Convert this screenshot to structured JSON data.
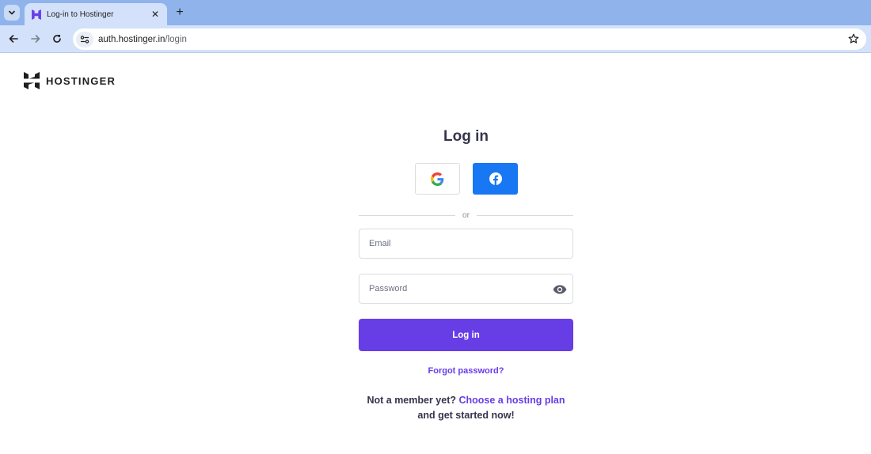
{
  "browser": {
    "tab_title": "Log-in to Hostinger",
    "url_host": "auth.hostinger.in",
    "url_path": "/login"
  },
  "page": {
    "logo_text": "HOSTINGER",
    "title": "Log in",
    "divider_text": "or",
    "email_placeholder": "Email",
    "password_placeholder": "Password",
    "login_button": "Log in",
    "forgot_password": "Forgot password?",
    "member_prefix": "Not a member yet?",
    "member_link": "Choose a hosting plan",
    "member_suffix": "and get started now!"
  },
  "colors": {
    "brand": "#673de6",
    "facebook": "#1877f2",
    "text": "#36344d"
  }
}
